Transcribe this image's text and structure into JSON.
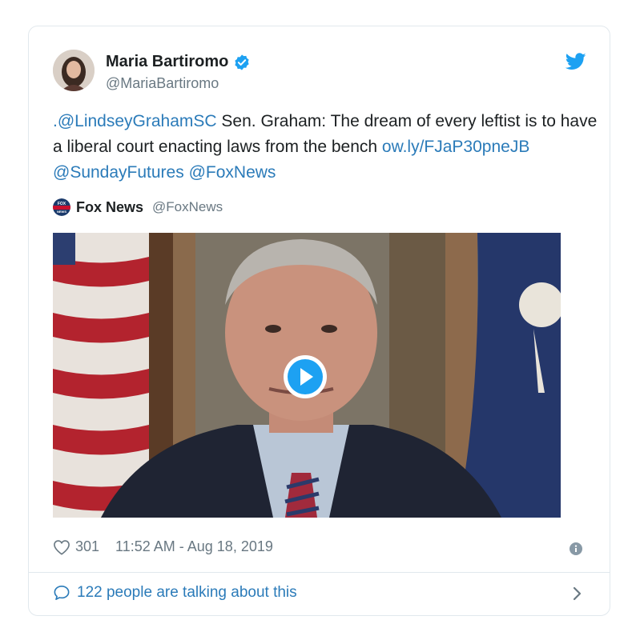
{
  "tweet": {
    "author_name": "Maria Bartiromo",
    "author_handle": "@MariaBartiromo",
    "text_mention": ".@LindseyGrahamSC",
    "text_body": " Sen. Graham: The dream of every leftist is to have a liberal court enacting laws from the bench ",
    "text_link": "ow.ly/FJaP30pneJB",
    "text_mention2": "@SundayFutures",
    "text_mention3": "@FoxNews"
  },
  "quoted": {
    "name": "Fox News",
    "handle": "@FoxNews",
    "logo_text": "FOX NEWS"
  },
  "meta": {
    "likes": "301",
    "timestamp": "11:52 AM - Aug 18, 2019"
  },
  "footer": {
    "conversation": "122 people are talking about this"
  },
  "icons": {
    "verified": "verified-badge-icon",
    "bird": "twitter-bird-icon",
    "heart": "heart-icon",
    "info": "info-icon",
    "bubble": "speech-bubble-icon",
    "chevron": "chevron-right-icon",
    "play": "play-icon"
  },
  "colors": {
    "link": "#2b7bb9",
    "twitter_blue": "#1da1f2",
    "muted": "#697882",
    "border": "#e1e8ed"
  }
}
